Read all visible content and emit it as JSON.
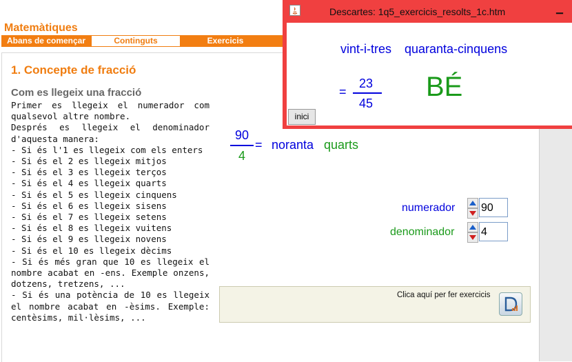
{
  "app": {
    "brand": "Matemàtiques"
  },
  "nav": {
    "tabs": [
      {
        "label": "Abans de començar"
      },
      {
        "label": "Continguts"
      },
      {
        "label": "Exercicis"
      }
    ]
  },
  "lesson": {
    "title": "1. Concepte de fracció",
    "subtitle": "Com es llegeix una fracció",
    "paragraphs": [
      "Primer es llegeix el numerador com qualsevol altre nombre.",
      "Després es llegeix el denominador d'aquesta manera:",
      "- Si és l'1 es llegeix com els enters",
      "- Si és el 2 es llegeix mitjos",
      "- Si és el 3 es llegeix terços",
      "- Si és el 4 es llegeix quarts",
      "- Si és el 5 es llegeix cinquens",
      "- Si és el 6 es llegeix sisens",
      "- Si és el 7 es llegeix setens",
      "- Si és el 8 es llegeix vuitens",
      "- Si és el 9 es llegeix novens",
      "- Si és el 10 es llegeix dècims",
      "- Si és més gran que 10 es llegeix el nombre acabat en -ens. Exemple onzens, dotzens, tretzens, ...",
      "- Si és una potència de 10 es llegeix el nombre acabat en -èsims. Exemple: centèsims, mil·lèsims, ..."
    ]
  },
  "applet": {
    "numerator": "90",
    "denominator": "4",
    "equals": "=",
    "numerator_word": "noranta",
    "denominator_word": "quarts",
    "numerator_label": "numerador",
    "denominator_label": "denominador",
    "numerator_value": "90",
    "denominator_value": "4",
    "exercise_prompt": "Clica aquí per fer exercicis"
  },
  "popup": {
    "title": "Descartes: 1q5_exercicis_resolts_1c.htm",
    "numerator_word": "vint-i-tres",
    "denominator_word": "quaranta-cinquens",
    "equals": "=",
    "numerator": "23",
    "denominator": "45",
    "verdict": "BÉ",
    "reset_button": "inici"
  },
  "colors": {
    "orange": "#f07d10",
    "blue": "#0000dd",
    "green": "#1a9a1a",
    "popup_red": "#f04040"
  },
  "icons": [
    "java-icon",
    "minimize-icon",
    "spin-up-icon",
    "spin-down-icon",
    "descartes-icon"
  ]
}
